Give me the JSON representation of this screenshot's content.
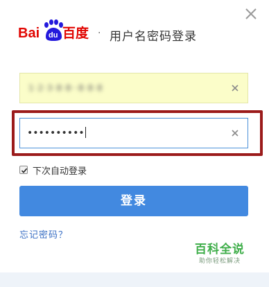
{
  "header": {
    "separator": "·",
    "title": "用户名密码登录",
    "close_icon": "close-icon"
  },
  "logo": {
    "text_left": "Bai",
    "paw_text": "du",
    "text_right": "百度",
    "brand_red": "#e10602",
    "brand_blue": "#2319dc"
  },
  "form": {
    "username": {
      "value": "1·2·3·8·8··8·8·8",
      "obscured": true,
      "background": "#fbfdc9"
    },
    "password": {
      "value": "••••••••••",
      "focused": true
    },
    "highlight_color": "#9b1b1b",
    "remember": {
      "label": "下次自动登录",
      "checked": true
    },
    "login_button": {
      "label": "登录",
      "color": "#4289e0"
    },
    "forgot_link": "忘记密码？"
  },
  "watermark": {
    "title": "百科全说",
    "subtitle": "助你轻松解决"
  }
}
